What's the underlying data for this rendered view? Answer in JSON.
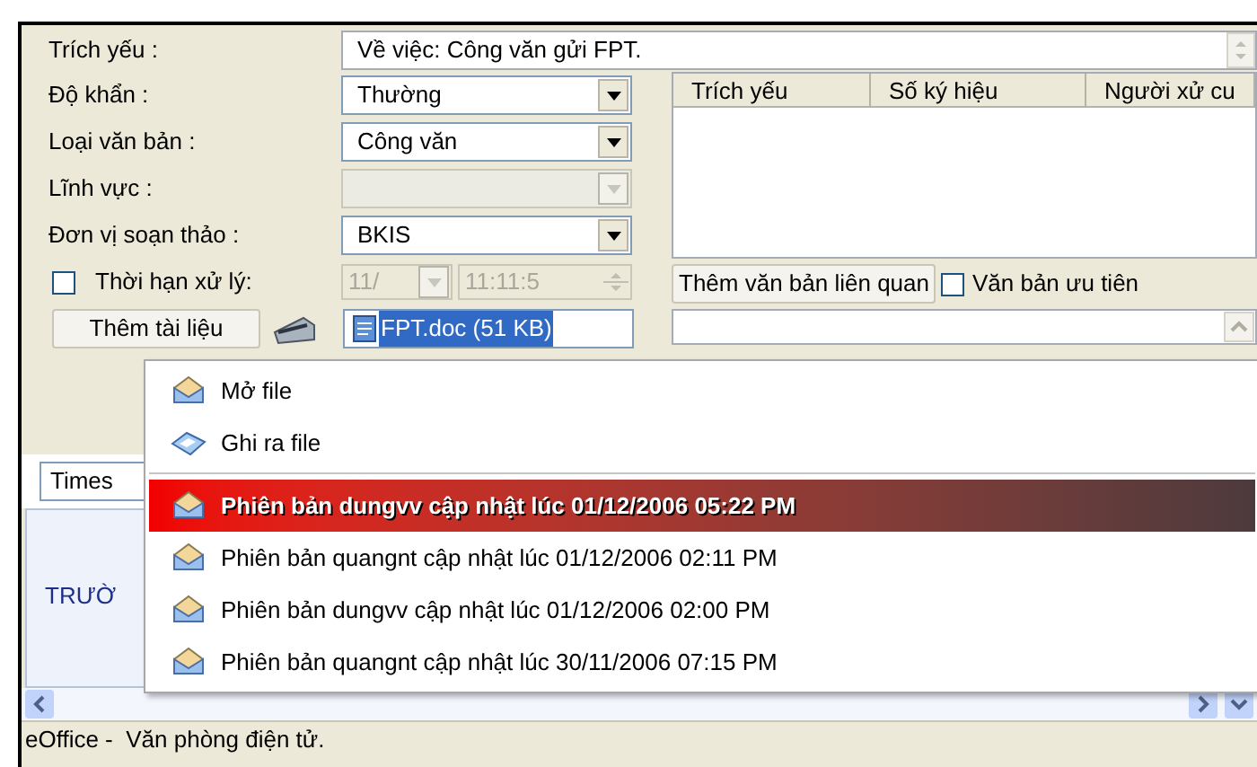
{
  "summary": {
    "label": "Trích yếu :",
    "value": "Về việc: Công văn gửi FPT."
  },
  "fields": [
    {
      "label": "Độ khẩn :",
      "value": "Thường",
      "disabled": false
    },
    {
      "label": "Loại văn bản :",
      "value": "Công văn",
      "disabled": false
    },
    {
      "label": "Lĩnh vực :",
      "disabled": true
    },
    {
      "label": "Đơn vị soạn thảo :",
      "value": "BKIS",
      "disabled": false
    }
  ],
  "deadline": {
    "label": "Thời hạn xử lý:",
    "checked": false,
    "date": "11/",
    "time": "11:11:5",
    "disabled": true
  },
  "attachment": {
    "button": "Thêm tài liệu",
    "file": "FPT.doc (51 KB)",
    "selected": true
  },
  "related": {
    "columns": [
      "Trích yếu",
      "Số ký hiệu",
      "Người xử cu"
    ],
    "add_button": "Thêm văn bản liên quan",
    "priority": {
      "label": "Văn bản ưu tiên",
      "checked": false
    }
  },
  "font_field": {
    "value": "Times"
  },
  "editor": {
    "text": "TRƯỜ"
  },
  "menu": {
    "items": [
      {
        "kind": "open",
        "label": "Mở file",
        "selected": false
      },
      {
        "kind": "save",
        "label": "Ghi ra file",
        "selected": false
      },
      {
        "kind": "separator"
      },
      {
        "kind": "version",
        "label": "Phiên bản dungvv cập nhật lúc 01/12/2006 05:22 PM",
        "selected": true
      },
      {
        "kind": "version",
        "label": "Phiên bản quangnt cập nhật lúc 01/12/2006 02:11 PM",
        "selected": false
      },
      {
        "kind": "version",
        "label": "Phiên bản dungvv cập nhật lúc 01/12/2006 02:00 PM",
        "selected": false
      },
      {
        "kind": "version",
        "label": "Phiên bản quangnt cập nhật lúc 30/11/2006 07:15 PM",
        "selected": false
      }
    ]
  },
  "status_bar": {
    "text": "eOffice -  Văn phòng điện tử."
  }
}
